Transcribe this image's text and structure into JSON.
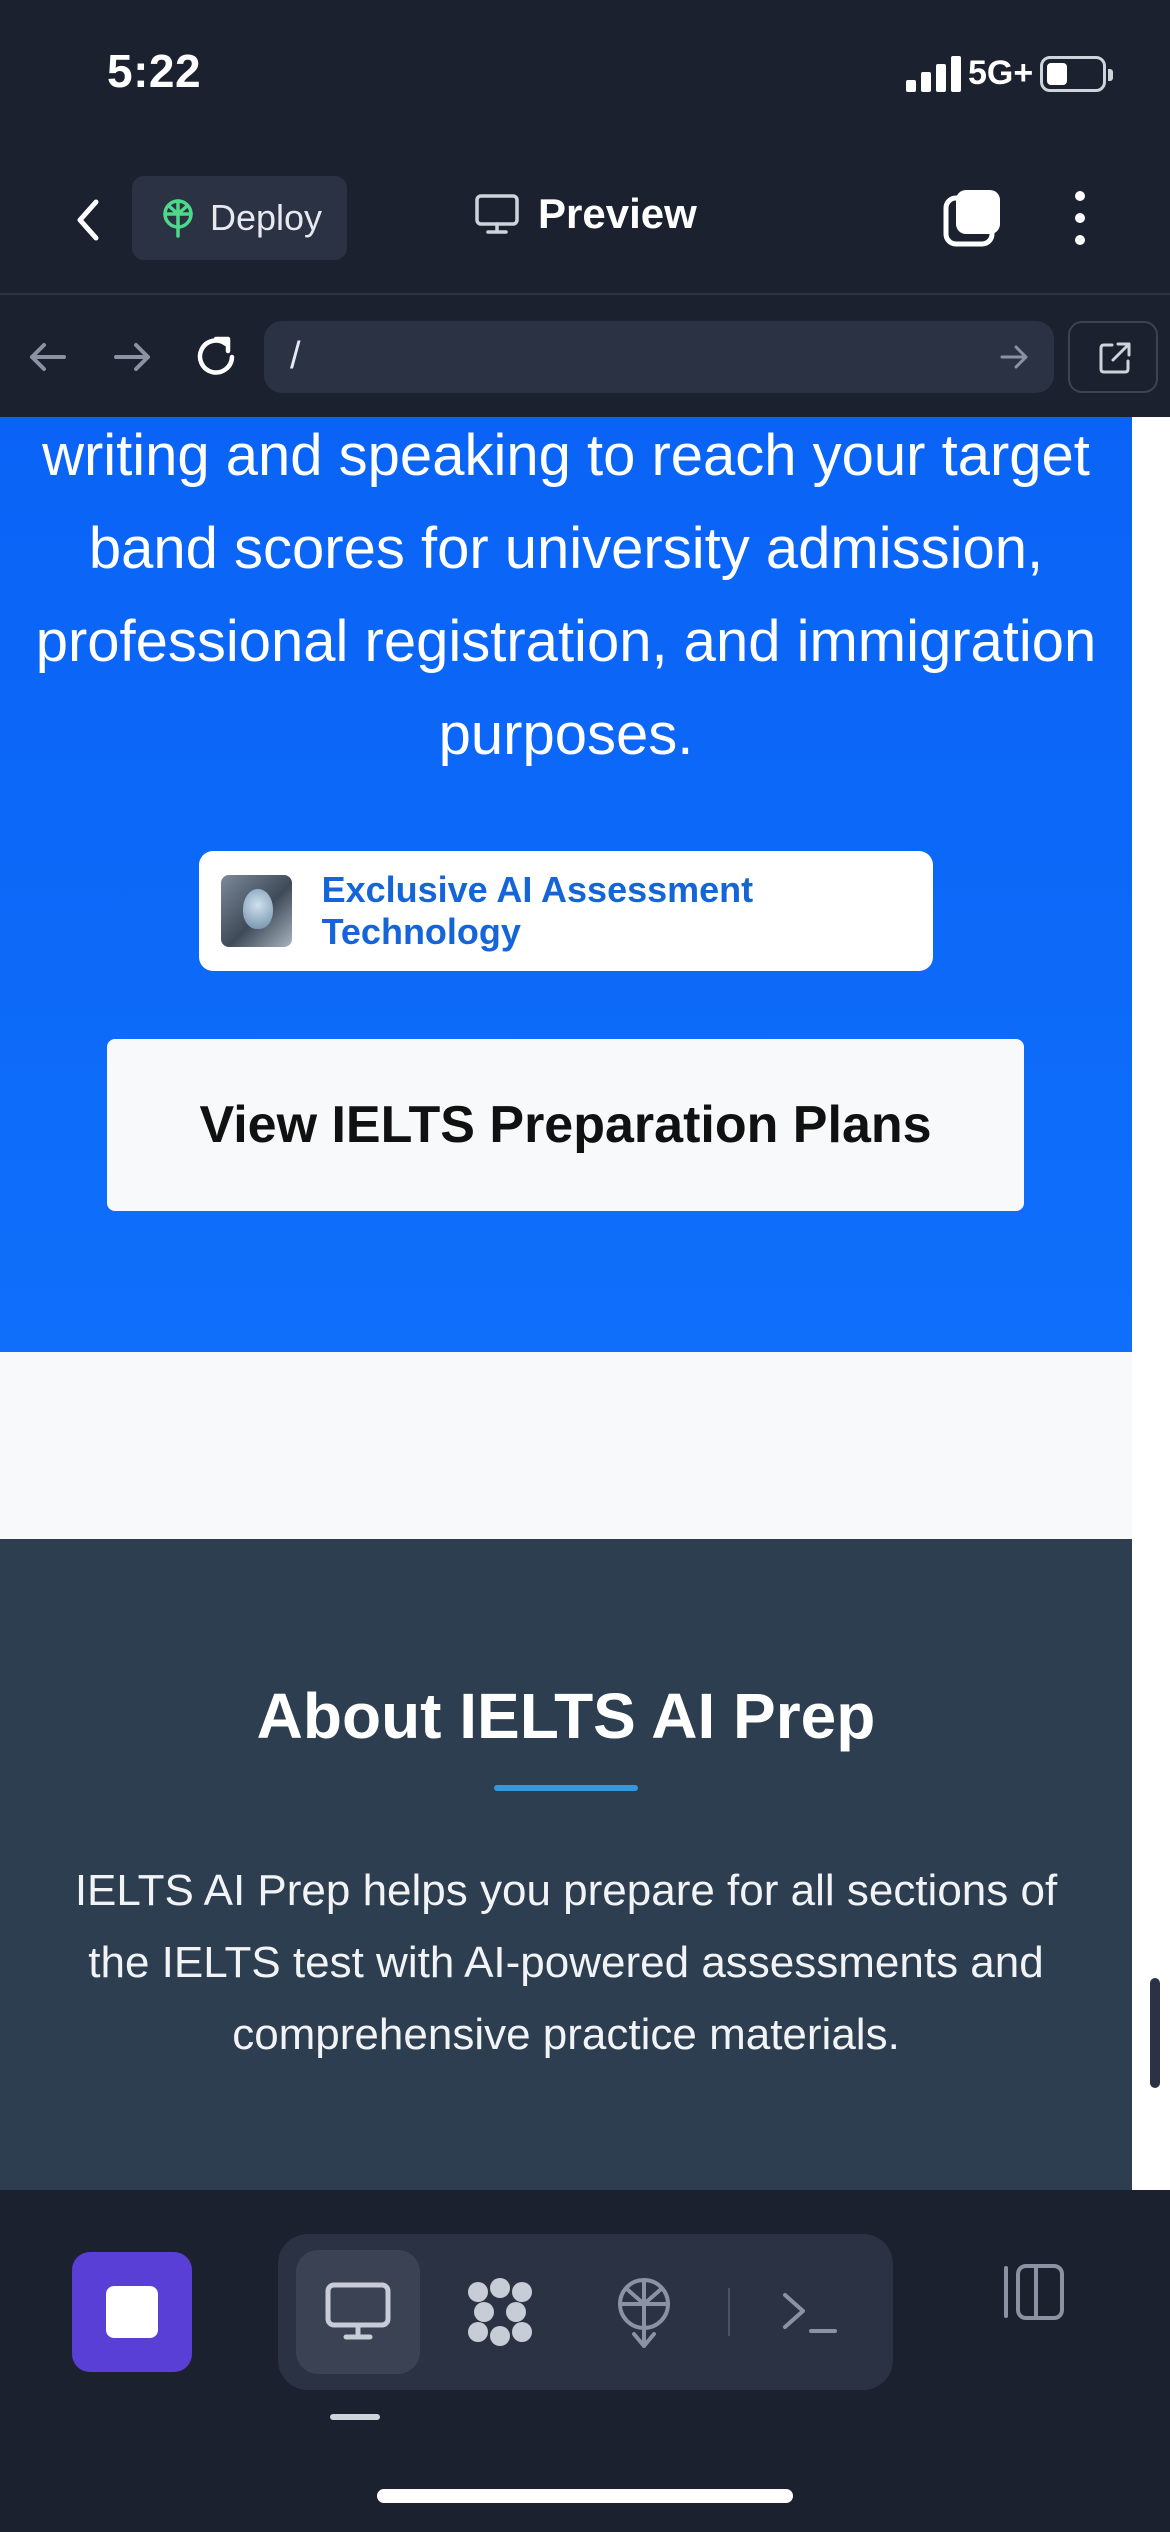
{
  "status_bar": {
    "time": "5:22",
    "network": "5G+"
  },
  "app_bar": {
    "deploy_label": "Deploy",
    "preview_label": "Preview"
  },
  "browser": {
    "url": "/"
  },
  "hero": {
    "text": "writing and speaking to reach your target band scores for university admission, professional registration, and immigration purposes.",
    "badge_label": "Exclusive AI Assessment Technology",
    "cta_label": "View IELTS Preparation Plans"
  },
  "about": {
    "title": "About IELTS AI Prep",
    "text": "IELTS AI Prep helps you prepare for all sections of the IELTS test with AI-powered assessments and comprehensive practice materials."
  },
  "colors": {
    "hero_blue": "#0a63f6",
    "about_bg": "#2d3e50",
    "accent_line": "#3498db",
    "stop_button": "#5a3fd6",
    "badge_text": "#1565d8"
  },
  "icons": [
    "back-icon",
    "deploy-icon",
    "monitor-icon",
    "tabs-icon",
    "more-icon",
    "arrow-left-icon",
    "arrow-right-icon",
    "reload-icon",
    "go-icon",
    "external-link-icon",
    "stop-icon",
    "monitor-icon",
    "apps-icon",
    "deploy-icon",
    "terminal-icon",
    "panels-icon"
  ]
}
